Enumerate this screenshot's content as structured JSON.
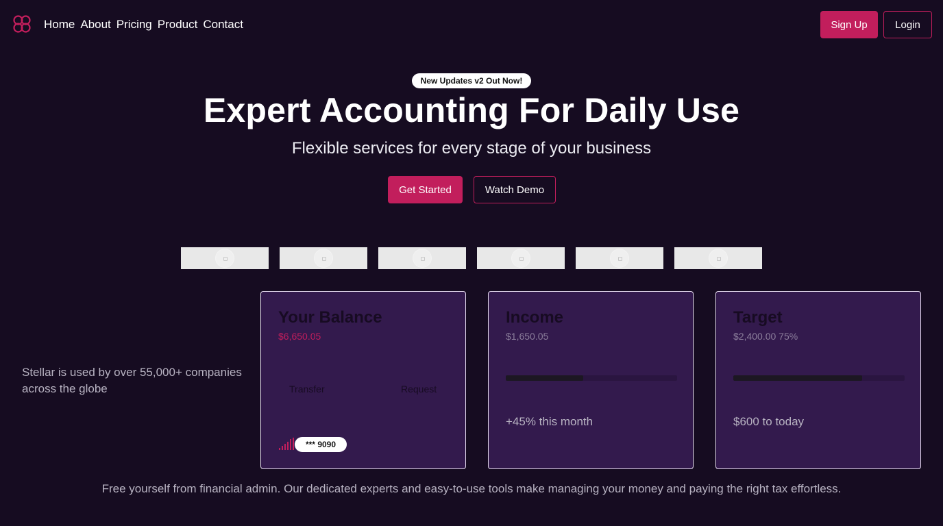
{
  "nav": {
    "links": [
      "Home",
      "About",
      "Pricing",
      "Product",
      "Contact"
    ],
    "signup_label": "Sign Up",
    "login_label": "Login"
  },
  "hero": {
    "badge": "New Updates v2 Out Now!",
    "title": "Expert Accounting For Daily Use",
    "subtitle": "Flexible services for every stage of your business",
    "primary_cta": "Get Started",
    "secondary_cta": "Watch Demo"
  },
  "partner_logos": [
    "logo-placeholder",
    "logo-placeholder",
    "logo-placeholder",
    "logo-placeholder",
    "logo-placeholder",
    "logo-placeholder"
  ],
  "companies_text": "Stellar is used by over 55,000+ companies across the globe",
  "cards": {
    "balance": {
      "title": "Your Balance",
      "amount": "$6,650.05",
      "transfer_label": "Transfer",
      "request_label": "Request",
      "card_number": "*** 9090"
    },
    "income": {
      "title": "Income",
      "amount": "$1,650.05",
      "progress": 0.45,
      "note": "+45% this month"
    },
    "target": {
      "title": "Target",
      "amount": "$2,400.00 75%",
      "progress": 0.75,
      "note": "$600 to today"
    }
  },
  "tagline": "Free yourself from financial admin. Our dedicated experts and easy-to-use tools make managing your money and paying the right tax effortless.",
  "colors": {
    "background": "#160c21",
    "accent": "#c21e5c",
    "card": "#331a4d"
  }
}
